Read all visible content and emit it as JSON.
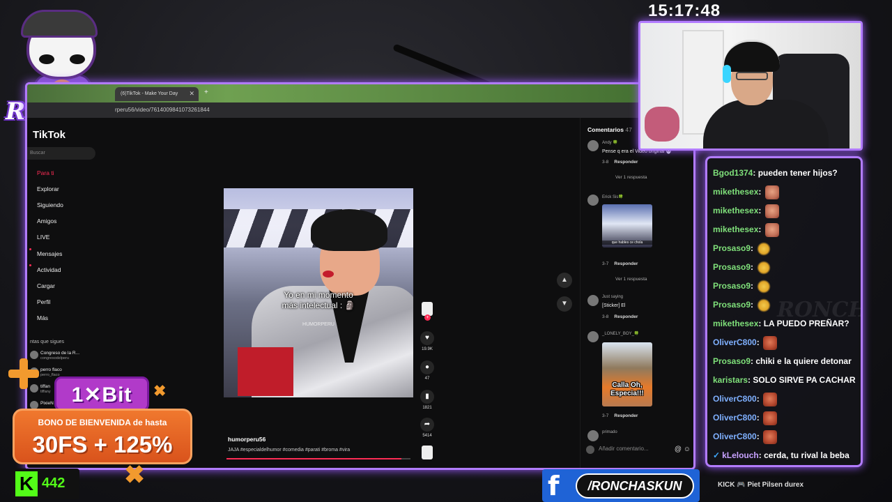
{
  "stream": {
    "logo_text": "RONCHAS",
    "clock": "15:17:48",
    "viewers": "442",
    "facebook_handle": "/RONCHASKUN",
    "sponsors": "KICK 🎮 Piet Pilsen durex"
  },
  "browser": {
    "tab_title": "(6)TikTok - Make Your Day",
    "new_tab": "+",
    "url": "rperu56/video/7614009841073261844"
  },
  "tiktok": {
    "logo": "TikTok",
    "search_placeholder": "Buscar",
    "nav": [
      "Para ti",
      "Explorar",
      "Siguiendo",
      "Amigos",
      "LIVE",
      "Mensajes",
      "Actividad",
      "Cargar",
      "Perfil",
      "Más"
    ],
    "following_header": "ntas que sigues",
    "accounts": [
      {
        "name": "Congreso de la R...",
        "handle": "congresodelperu"
      },
      {
        "name": "perro flaco",
        "handle": "perro_flaco"
      },
      {
        "name": "tiffan",
        "handle": "tiffany"
      },
      {
        "name": "PixieN",
        "handle": ""
      }
    ],
    "video": {
      "caption_line1": "Yo en mi momento",
      "caption_line2": "más intelectual : 🗿",
      "watermark": "HUMORPERU",
      "author": "humorperu56",
      "description": "JAJA #especialdelhumor #comedia #parati #broma #vira",
      "progress": 0.95,
      "likes": "19.9K",
      "comments": "47",
      "saves": "1821",
      "shares": "5414"
    },
    "comments_panel": {
      "title": "Comentarios",
      "count": "47",
      "reply_label": "Responder",
      "comments": [
        {
          "user": "Andy 🍀",
          "text": "Pense q era el Video original 💀",
          "date": "3-8",
          "replies": "Ver 1 respuesta"
        },
        {
          "user": "Erick Sis🍀",
          "sticker_caption": "que hables ce chola",
          "date": "3-7",
          "replies": "Ver 1 respuesta"
        },
        {
          "user": "Just saying",
          "text": "[Sticker] El",
          "date": "3-8"
        },
        {
          "user": "_LONELY_BOY_🍀",
          "gif_caption": "Calla Oh, Especia!!!",
          "date": "3-7"
        },
        {
          "user": "primado",
          "text": ""
        }
      ],
      "input_placeholder": "Añadir comentario...",
      "input_icons": "@ ☺"
    }
  },
  "chat": {
    "watermark": "RONCHAS",
    "messages": [
      {
        "user": "Bgod1374",
        "color": "#7fe07a",
        "text": "pueden tener hijos?",
        "emote": ""
      },
      {
        "user": "mikethesex",
        "color": "#7fe07a",
        "text": "",
        "emote": "face"
      },
      {
        "user": "mikethesex",
        "color": "#7fe07a",
        "text": "",
        "emote": "face"
      },
      {
        "user": "mikethesex",
        "color": "#7fe07a",
        "text": "",
        "emote": "face"
      },
      {
        "user": "Prosaso9",
        "color": "#7fe07a",
        "text": "",
        "emote": "clap"
      },
      {
        "user": "Prosaso9",
        "color": "#7fe07a",
        "text": "",
        "emote": "clap"
      },
      {
        "user": "Prosaso9",
        "color": "#7fe07a",
        "text": "",
        "emote": "clap"
      },
      {
        "user": "Prosaso9",
        "color": "#7fe07a",
        "text": "",
        "emote": "clap"
      },
      {
        "user": "mikethesex",
        "color": "#7fe07a",
        "text": "LA PUEDO PREÑAR?",
        "emote": ""
      },
      {
        "user": "OliverC800",
        "color": "#7fb0ff",
        "text": "",
        "emote": "angry"
      },
      {
        "user": "Prosaso9",
        "color": "#7fe07a",
        "text": "chiki e la quiere detonar",
        "emote": ""
      },
      {
        "user": "karistars",
        "color": "#7fe07a",
        "text": "SOLO SIRVE PA CACHAR",
        "emote": ""
      },
      {
        "user": "OliverC800",
        "color": "#7fb0ff",
        "text": "",
        "emote": "angry"
      },
      {
        "user": "OliverC800",
        "color": "#7fb0ff",
        "text": "",
        "emote": "angry"
      },
      {
        "user": "OliverC800",
        "color": "#7fb0ff",
        "text": "",
        "emote": "angry"
      },
      {
        "user": "kLelouch",
        "color": "#c8a2ff",
        "text": "cerda, tu rival la beba",
        "emote": "",
        "badge": "✓"
      }
    ]
  },
  "promo": {
    "brand": "1✕Bit",
    "line1": "BONO DE BIENVENIDA de hasta",
    "line2": "30FS + 125%"
  }
}
